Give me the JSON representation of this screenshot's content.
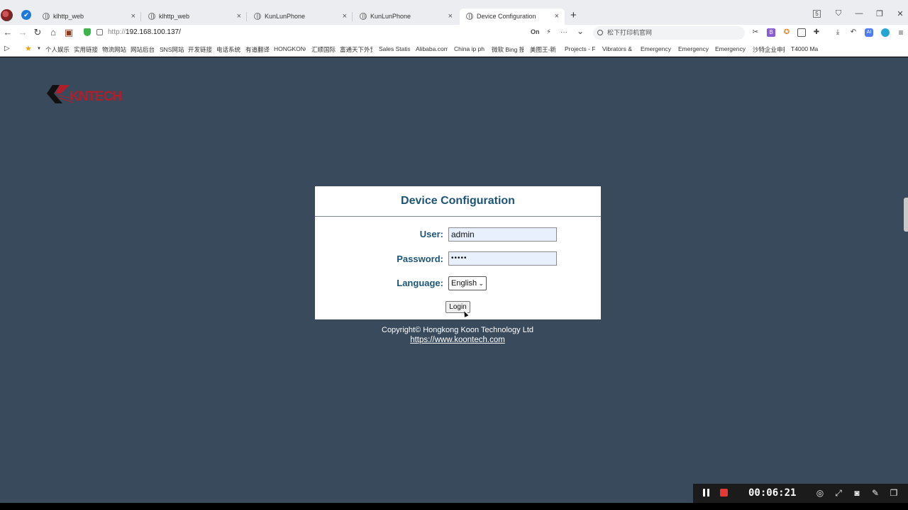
{
  "browser": {
    "tabs": [
      {
        "label": "klhttp_web"
      },
      {
        "label": "klhttp_web"
      },
      {
        "label": "KunLunPhone"
      },
      {
        "label": "KunLunPhone"
      },
      {
        "label": "Device Configuration"
      }
    ],
    "new_tab": "+",
    "close_glyph": "×",
    "window": {
      "sidebar": "5",
      "minimize": "—",
      "restore": "❐",
      "close": "✕"
    },
    "url_scheme": "http://",
    "url_host": "192.168.100.137/",
    "address_tools": {
      "on": "On",
      "bolt": "⚡",
      "more": "···",
      "menu": "⌄"
    },
    "search_placeholder": "松下打印机官网",
    "toolbar_icons": [
      "scissors-icon",
      "extension-icon",
      "game-icon",
      "window-icon",
      "puzzle-icon",
      "download-icon",
      "undo-icon",
      "ai-icon",
      "edge-icon",
      "menu-icon"
    ],
    "bookmarks": [
      "个人娱乐",
      "实用链接",
      "物流网站",
      "网站后台",
      "SNS网站",
      "开发链接",
      "电话系统",
      "有道翻译",
      "HONGKONG",
      "汇顺国际",
      "富通天下外贸",
      "Sales Statis",
      "Alibaba.com",
      "China ip ph",
      "微软 Bing 搜",
      "美图王-新",
      "Projects - F",
      "Vibrators &",
      "Emergency",
      "Emergency",
      "Emergency",
      "沙特企业申报",
      "T4000 Ma"
    ]
  },
  "page": {
    "logo_text": "KNTECH",
    "card": {
      "title": "Device Configuration",
      "user_label": "User:",
      "user_value": "admin",
      "password_label": "Password:",
      "password_value": "•••••",
      "language_label": "Language:",
      "language_selected": "English",
      "login_label": "Login"
    },
    "copyright": "Copyright© Hongkong Koon Technology Ltd",
    "site_link": "https://www.koontech.com"
  },
  "recorder": {
    "timer": "00:06:21"
  },
  "colors": {
    "page_bg": "#384a5c",
    "title_blue": "#1d5577",
    "logo_red": "#b01e2a",
    "input_fill": "#e8f0fe"
  }
}
